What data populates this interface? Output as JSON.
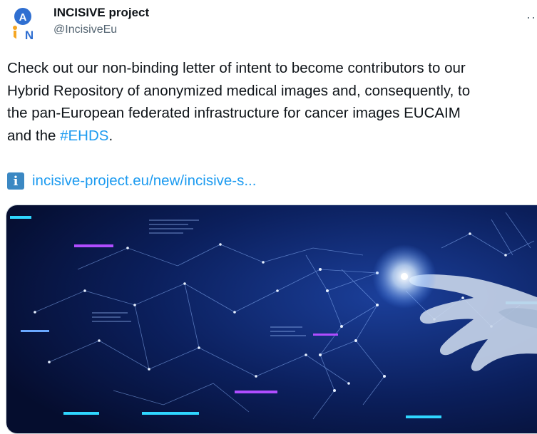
{
  "author": {
    "name": "INCISIVE project",
    "handle": "@IncisiveEu",
    "avatar_text": "AIN"
  },
  "more_icon": "more-horizontal-icon",
  "tweet": {
    "lines": [
      "Check out our non-binding letter of intent to become contributors to our",
      "Hybrid Repository of anonymized medical images and, consequently, to",
      "the pan-European federated infrastructure for cancer images EUCAIM",
      "and the "
    ],
    "hashtag": "#EHDS",
    "end_punct": "."
  },
  "link": {
    "icon": "info-icon",
    "icon_glyph": "i",
    "text": "incisive-project.eu/new/incisive-s..."
  },
  "colors": {
    "link": "#1d9bf0",
    "text": "#0f1419",
    "secondary": "#536471",
    "info_icon_bg": "#3b88c3",
    "media_bg": "#0a1a4a"
  }
}
